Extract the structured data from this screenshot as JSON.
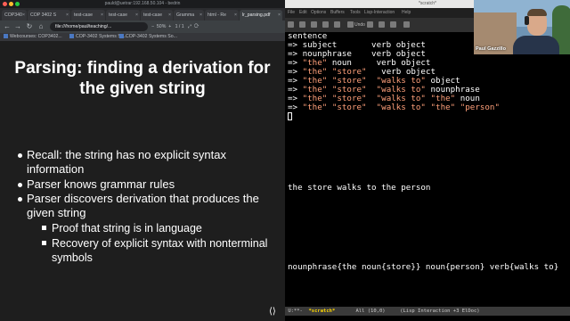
{
  "browser": {
    "window_title": "pauld@uetrar:192.168.50.104 - bedrin",
    "window_dots": [
      "#ff5f56",
      "#ffbd2e",
      "#27c93f"
    ],
    "tabs": [
      {
        "label": "COP340"
      },
      {
        "label": "COP 3402 S"
      },
      {
        "label": "test-case"
      },
      {
        "label": "test-case"
      },
      {
        "label": "test-case"
      },
      {
        "label": "Gramma"
      },
      {
        "label": "html - Re"
      },
      {
        "label": "lr_parsing.pdf",
        "active": true
      }
    ],
    "address": "file:///home/paul/teaching/...",
    "zoom": "50%",
    "page_indicator": "1 / 1",
    "bookmarks": [
      "Webcourses: COP3402...",
      "COP-3402 Systems So...",
      "COP-3402 Systems So..."
    ]
  },
  "slide": {
    "title": "Parsing: finding a derivation for the given string",
    "bullets": [
      "Recall: the string has no explicit syntax information",
      "Parser knows grammar rules",
      "Parser discovers derivation that produces the given string"
    ],
    "subbullets": [
      "Proof that string is in language",
      "Recovery of explicit syntax with nonterminal symbols"
    ]
  },
  "emacs": {
    "window_title": "*scratch*",
    "menu": [
      "File",
      "Edit",
      "Options",
      "Buffers",
      "Tools",
      "Lisp-Interaction",
      "Help"
    ],
    "toolbar": [
      "",
      "",
      "",
      "",
      "",
      "",
      "",
      "Undo",
      "",
      "",
      "",
      ""
    ],
    "buffer": {
      "first_line": "sentence",
      "derivation": [
        [
          {
            "t": "=> "
          },
          {
            "t": "subject       verb object"
          }
        ],
        [
          {
            "t": "=> "
          },
          {
            "t": "nounphrase    verb object"
          }
        ],
        [
          {
            "t": "=> "
          },
          {
            "t": "\"the\"",
            "s": true
          },
          {
            "t": " noun     verb object"
          }
        ],
        [
          {
            "t": "=> "
          },
          {
            "t": "\"the\"",
            "s": true
          },
          {
            "t": " "
          },
          {
            "t": "\"store\"",
            "s": true
          },
          {
            "t": "   verb object"
          }
        ],
        [
          {
            "t": "=> "
          },
          {
            "t": "\"the\"",
            "s": true
          },
          {
            "t": " "
          },
          {
            "t": "\"store\"",
            "s": true
          },
          {
            "t": "  "
          },
          {
            "t": "\"walks to\"",
            "s": true
          },
          {
            "t": " object"
          }
        ],
        [
          {
            "t": "=> "
          },
          {
            "t": "\"the\"",
            "s": true
          },
          {
            "t": " "
          },
          {
            "t": "\"store\"",
            "s": true
          },
          {
            "t": "  "
          },
          {
            "t": "\"walks to\"",
            "s": true
          },
          {
            "t": " nounphrase"
          }
        ],
        [
          {
            "t": "=> "
          },
          {
            "t": "\"the\"",
            "s": true
          },
          {
            "t": " "
          },
          {
            "t": "\"store\"",
            "s": true
          },
          {
            "t": "  "
          },
          {
            "t": "\"walks to\"",
            "s": true
          },
          {
            "t": " "
          },
          {
            "t": "\"the\"",
            "s": true
          },
          {
            "t": " noun"
          }
        ],
        [
          {
            "t": "=> "
          },
          {
            "t": "\"the\"",
            "s": true
          },
          {
            "t": " "
          },
          {
            "t": "\"store\"",
            "s": true
          },
          {
            "t": "  "
          },
          {
            "t": "\"walks to\"",
            "s": true
          },
          {
            "t": " "
          },
          {
            "t": "\"the\"",
            "s": true
          },
          {
            "t": " "
          },
          {
            "t": "\"person\"",
            "s": true
          }
        ]
      ],
      "sentence_line": "the store walks to the person",
      "tree_line": "nounphrase{the noun{store}} noun{person} verb{walks to}"
    },
    "modeline": {
      "status": "U:**-",
      "buffer_name": "*scratch*",
      "position": "All (10,0)",
      "modes": "(Lisp Interaction +3 ElDoc)"
    },
    "string_color": "#ffa07a"
  },
  "webcam": {
    "name": "Paul Gazzillo"
  }
}
